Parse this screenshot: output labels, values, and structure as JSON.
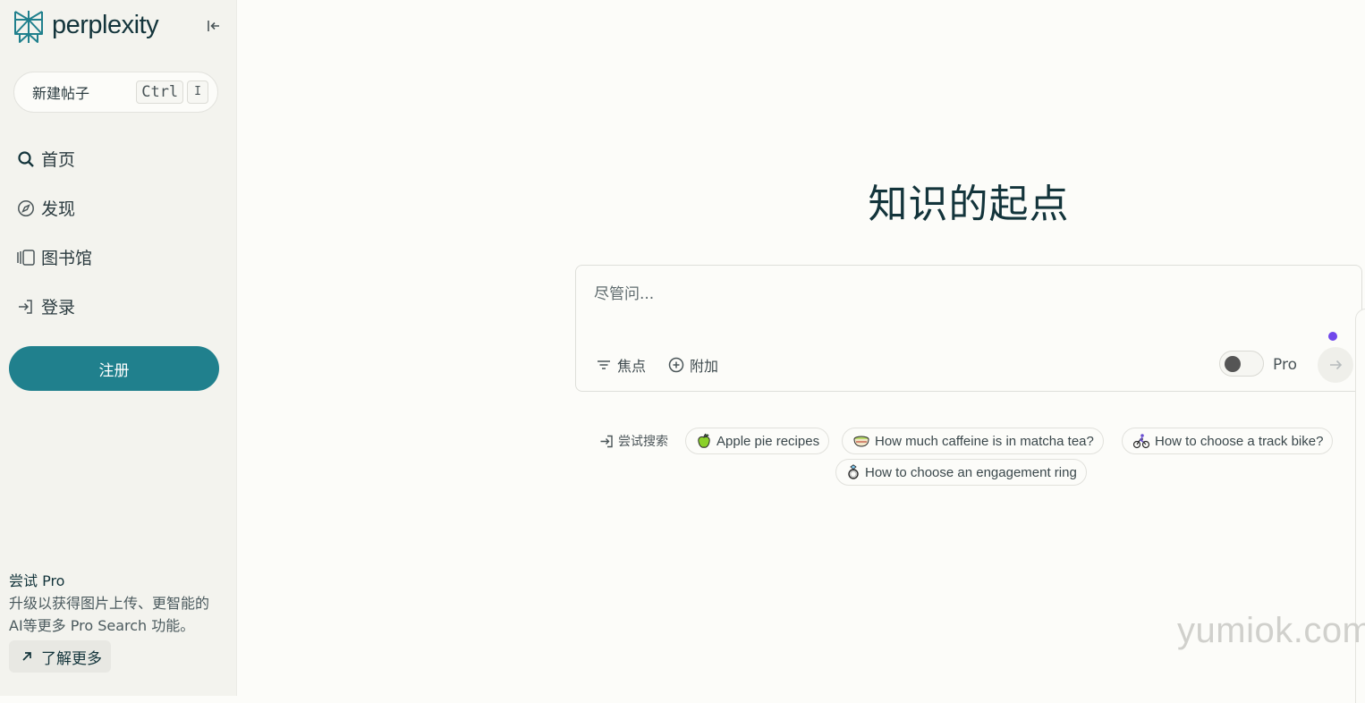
{
  "sidebar": {
    "logo_text": "perplexity",
    "new_thread": {
      "label": "新建帖子",
      "shortcut_key1": "Ctrl",
      "shortcut_key2": "I"
    },
    "nav": [
      {
        "label": "首页",
        "icon": "search-icon"
      },
      {
        "label": "发现",
        "icon": "compass-icon"
      },
      {
        "label": "图书馆",
        "icon": "library-icon"
      },
      {
        "label": "登录",
        "icon": "sign-in-icon"
      }
    ],
    "signup_label": "注册",
    "pro": {
      "title": "尝试 Pro",
      "description": "升级以获得图片上传、更智能的AI等更多 Pro Search 功能。",
      "learn_more": "了解更多"
    }
  },
  "main": {
    "headline": "知识的起点",
    "ask": {
      "placeholder": "尽管问...",
      "focus_label": "焦点",
      "attach_label": "附加",
      "pro_label": "Pro",
      "pro_enabled": false
    },
    "try_label": "尝试搜索",
    "suggestions": [
      {
        "label": "Apple pie recipes",
        "icon": "green-apple-icon"
      },
      {
        "label": "How much caffeine is in matcha tea?",
        "icon": "tea-bowl-icon"
      },
      {
        "label": "How to choose a track bike?",
        "icon": "cyclist-icon"
      },
      {
        "label": "How to choose an engagement ring",
        "icon": "ring-icon"
      }
    ]
  },
  "watermark": "yumiok.com",
  "colors": {
    "accent": "#20808d",
    "background": "#fcfcf9",
    "sidebar": "#f3f3ee",
    "indicator": "#7047eb"
  }
}
